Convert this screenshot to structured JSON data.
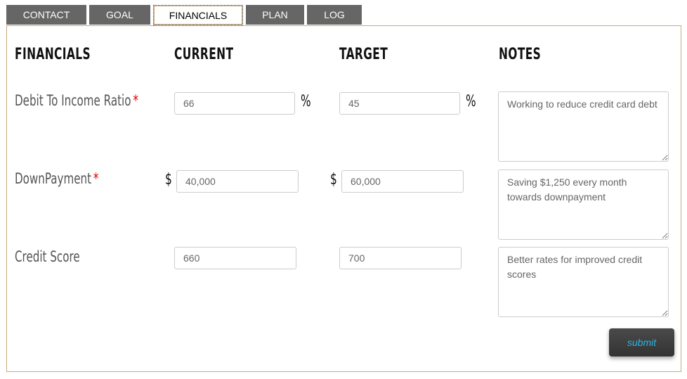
{
  "tabs": [
    {
      "label": "CONTACT",
      "active": false
    },
    {
      "label": "GOAL",
      "active": false
    },
    {
      "label": "FINANCIALS",
      "active": true
    },
    {
      "label": "PLAN",
      "active": false
    },
    {
      "label": "LOG",
      "active": false
    }
  ],
  "columns": {
    "financials": "FINANCIALS",
    "current": "CURRENT",
    "target": "TARGET",
    "notes": "NOTES"
  },
  "rows": [
    {
      "label": "Debit To Income Ratio",
      "required": "*",
      "current_prefix": "",
      "current_value": "66",
      "current_suffix": "%",
      "target_prefix": "",
      "target_value": "45",
      "target_suffix": "%",
      "notes": "Working to reduce credit card debt"
    },
    {
      "label": "DownPayment",
      "required": "*",
      "current_prefix": "$",
      "current_value": "40,000",
      "current_suffix": "",
      "target_prefix": "$",
      "target_value": "60,000",
      "target_suffix": "",
      "notes": "Saving $1,250 every month towards downpayment"
    },
    {
      "label": "Credit Score",
      "required": "",
      "current_prefix": "",
      "current_value": "660",
      "current_suffix": "",
      "target_prefix": "",
      "target_value": "700",
      "target_suffix": "",
      "notes": "Better rates for improved credit scores"
    }
  ],
  "submit_label": "submit",
  "colors": {
    "tab_bg": "#666666",
    "panel_border": "#c8a97c",
    "required": "#e00000",
    "submit_text": "#29b6e8"
  }
}
